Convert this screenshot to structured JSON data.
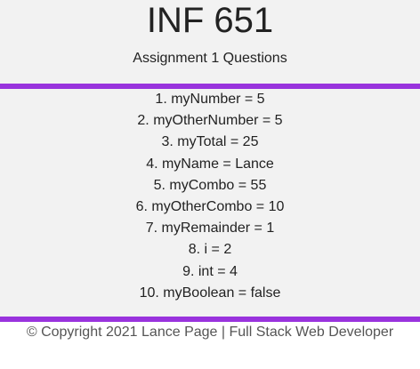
{
  "header": {
    "title": "INF 651",
    "subtitle": "Assignment 1 Questions"
  },
  "answers": [
    "1. myNumber = 5",
    "2. myOtherNumber = 5",
    "3. myTotal = 25",
    "4. myName = Lance",
    "5. myCombo = 55",
    "6. myOtherCombo = 10",
    "7. myRemainder = 1",
    "8. i = 2",
    "9. int = 4",
    "10. myBoolean = false"
  ],
  "footer": {
    "text": "© Copyright 2021 Lance Page | Full Stack Web Developer"
  },
  "colors": {
    "accent": "#9933dd",
    "panel_background": "#f2f2f2"
  }
}
